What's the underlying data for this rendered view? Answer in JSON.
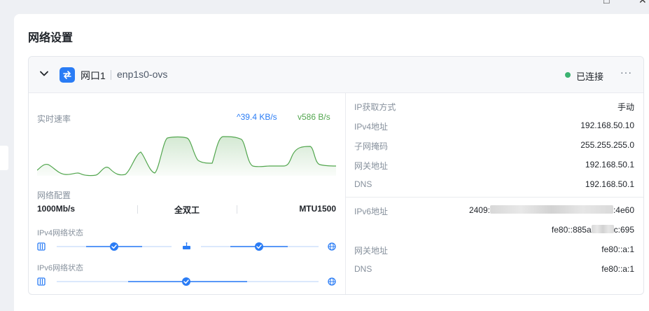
{
  "window": {
    "minimize_glyph": "□",
    "close_glyph": "✕"
  },
  "panel": {
    "title": "网络设置"
  },
  "interface": {
    "name": "网口1",
    "device": "enp1s0-ovs",
    "status": "已连接",
    "status_color": "#3cb371",
    "more_glyph": "···",
    "icon": "swap-arrows-icon",
    "accent": "#2a7cf5"
  },
  "speed": {
    "title": "实时速率",
    "upload": "^39.4 KB/s",
    "download": "v586 B/s"
  },
  "config": {
    "title": "网络配置",
    "speed": "1000Mb/s",
    "duplex": "全双工",
    "mtu": "MTU1500"
  },
  "ipv4_status": {
    "title": "IPv4网络状态"
  },
  "ipv6_status": {
    "title": "IPv6网络状态"
  },
  "ipv4": [
    {
      "label": "IP获取方式",
      "value": "手动"
    },
    {
      "label": "IPv4地址",
      "value": "192.168.50.10"
    },
    {
      "label": "子网掩码",
      "value": "255.255.255.0"
    },
    {
      "label": "网关地址",
      "value": "192.168.50.1"
    },
    {
      "label": "DNS",
      "value": "192.168.50.1"
    }
  ],
  "ipv6": {
    "address_label": "IPv6地址",
    "address1_prefix": "2409:",
    "address1_suffix": ":4e60",
    "address2_prefix": "fe80::885a",
    "address2_suffix": "c:695",
    "gateway_label": "网关地址",
    "gateway_value": "fe80::a:1",
    "dns_label": "DNS",
    "dns_value": "fe80::a:1"
  }
}
